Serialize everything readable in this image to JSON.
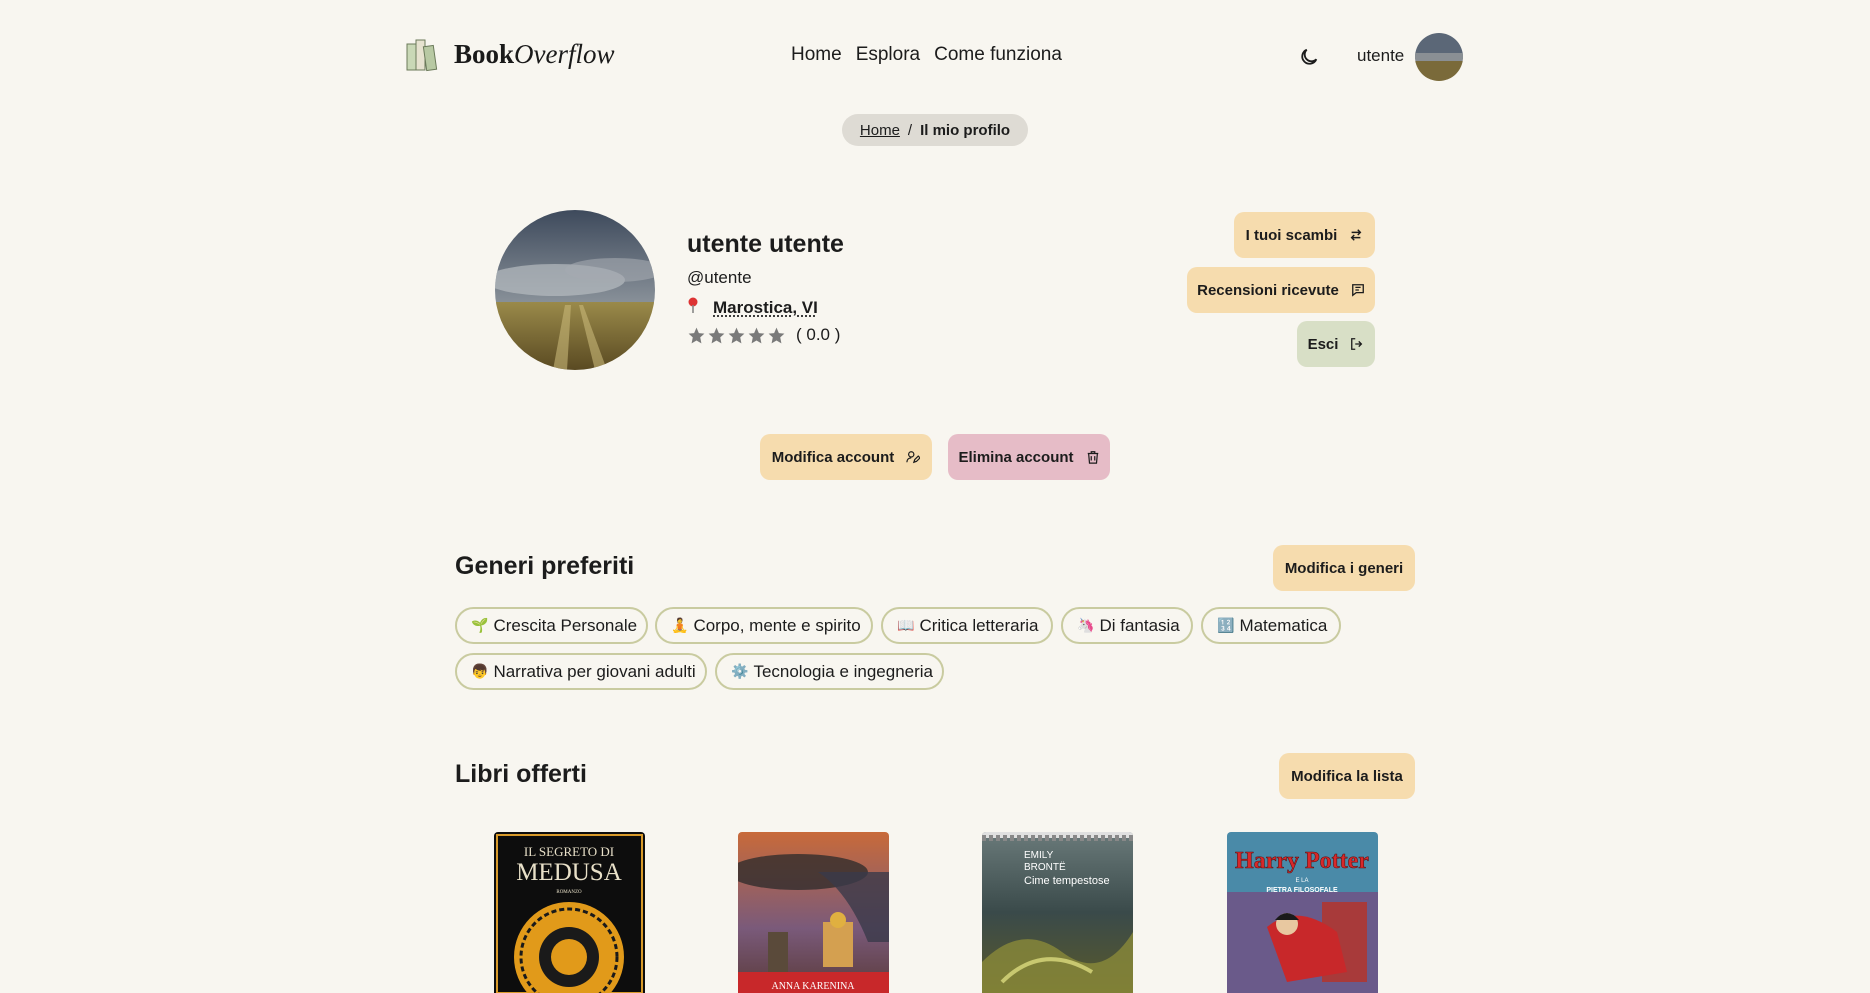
{
  "brand": {
    "name_bold": "Book",
    "name_italic": "Overflow"
  },
  "nav": {
    "links": [
      "Home",
      "Esplora",
      "Come funziona"
    ],
    "user_label": "utente"
  },
  "breadcrumb": {
    "home": "Home",
    "separator": "/",
    "current": "Il mio profilo"
  },
  "profile": {
    "full_name": "utente utente",
    "handle": "@utente",
    "location": "Marostica, VI",
    "rating_stars": 0,
    "rating_text": "( 0.0 )"
  },
  "actions": {
    "exchanges": "I tuoi scambi",
    "reviews": "Recensioni ricevute",
    "logout": "Esci",
    "edit_account": "Modifica account",
    "delete_account": "Elimina account"
  },
  "genres": {
    "title": "Generi preferiti",
    "edit_label": "Modifica i generi",
    "items": [
      {
        "emoji": "🌱",
        "label": "Crescita Personale"
      },
      {
        "emoji": "🧘",
        "label": "Corpo, mente e spirito"
      },
      {
        "emoji": "📖",
        "label": "Critica letteraria"
      },
      {
        "emoji": "🦄",
        "label": "Di fantasia"
      },
      {
        "emoji": "🔢",
        "label": "Matematica"
      },
      {
        "emoji": "👦",
        "label": "Narrativa per giovani adulti"
      },
      {
        "emoji": "⚙️",
        "label": "Tecnologia e ingegneria"
      }
    ]
  },
  "offered": {
    "title": "Libri offerti",
    "edit_label": "Modifica la lista",
    "books": [
      {
        "cover_line1": "IL SEGRETO DI",
        "cover_line2": "MEDUSA",
        "cover_line3": "ROMANZO"
      },
      {
        "cover_line1": "ANNA KARENINA",
        "cover_line2": "",
        "cover_line3": ""
      },
      {
        "cover_line1": "EMILY",
        "cover_line2": "BRONTË",
        "cover_line3": "Cime tempestose"
      },
      {
        "cover_line1": "Harry Potter",
        "cover_line2": "E LA",
        "cover_line3": "PIETRA FILOSOFALE"
      }
    ]
  },
  "colors": {
    "bg": "#f8f6f0",
    "peach": "#f6dcae",
    "green": "#d8dfc6",
    "pink": "#e6bcc7",
    "chip_border": "#c9cba0"
  }
}
